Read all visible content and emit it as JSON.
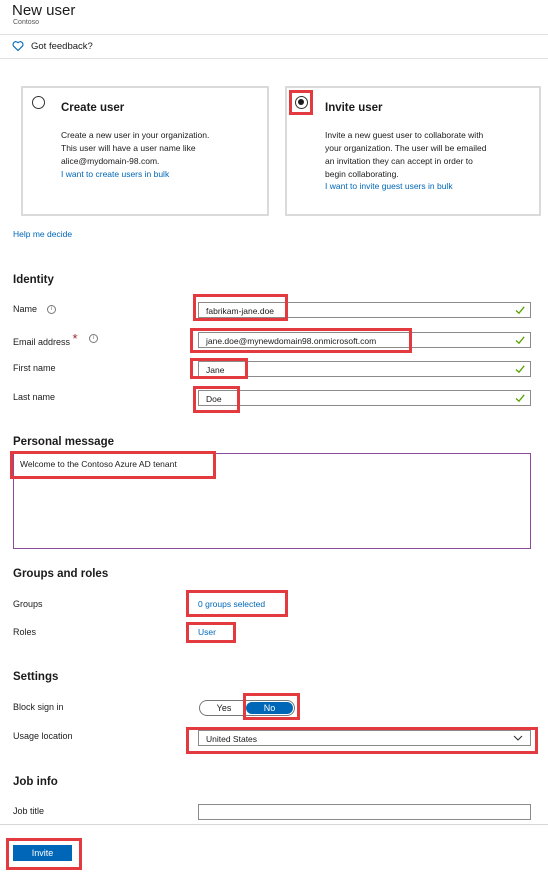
{
  "header": {
    "title": "New user",
    "subtitle": "Contoso",
    "feedback_label": "Got feedback?"
  },
  "options": {
    "create": {
      "title": "Create user",
      "description_lines": [
        "Create a new user in your organization.",
        "This user will have a user name like",
        "alice@mydomain-98.com."
      ],
      "bulk_link": "I want to create users in bulk",
      "selected": false
    },
    "invite": {
      "title": "Invite user",
      "description_lines": [
        "Invite a new guest user to collaborate with",
        "your organization. The user will be emailed",
        "an invitation they can accept in order to",
        "begin collaborating."
      ],
      "bulk_link": "I want to invite guest users in bulk",
      "selected": true
    }
  },
  "help_link": "Help me decide",
  "identity": {
    "section_title": "Identity",
    "name_label": "Name",
    "name_value": "fabrikam-jane.doe",
    "email_label": "Email address",
    "required_marker": "*",
    "email_value": "jane.doe@mynewdomain98.onmicrosoft.com",
    "first_name_label": "First name",
    "first_name_value": "Jane",
    "last_name_label": "Last name",
    "last_name_value": "Doe"
  },
  "personal_message": {
    "section_title": "Personal message",
    "value": "Welcome to the Contoso Azure AD tenant"
  },
  "groups_roles": {
    "section_title": "Groups and roles",
    "groups_label": "Groups",
    "groups_value": "0 groups selected",
    "roles_label": "Roles",
    "roles_value": "User"
  },
  "settings": {
    "section_title": "Settings",
    "block_sign_in_label": "Block sign in",
    "toggle_yes": "Yes",
    "toggle_no": "No",
    "toggle_selected": "No",
    "usage_location_label": "Usage location",
    "usage_location_value": "United States"
  },
  "job_info": {
    "section_title": "Job info",
    "job_title_label": "Job title",
    "job_title_value": ""
  },
  "footer": {
    "invite_label": "Invite"
  },
  "colors": {
    "accent": "#0067b8",
    "highlight_box": "#e23a3f",
    "valid_check": "#57a300",
    "required": "#a4262c"
  },
  "icons": [
    "heart-icon",
    "info-icon",
    "check-icon",
    "chevron-down-icon"
  ]
}
